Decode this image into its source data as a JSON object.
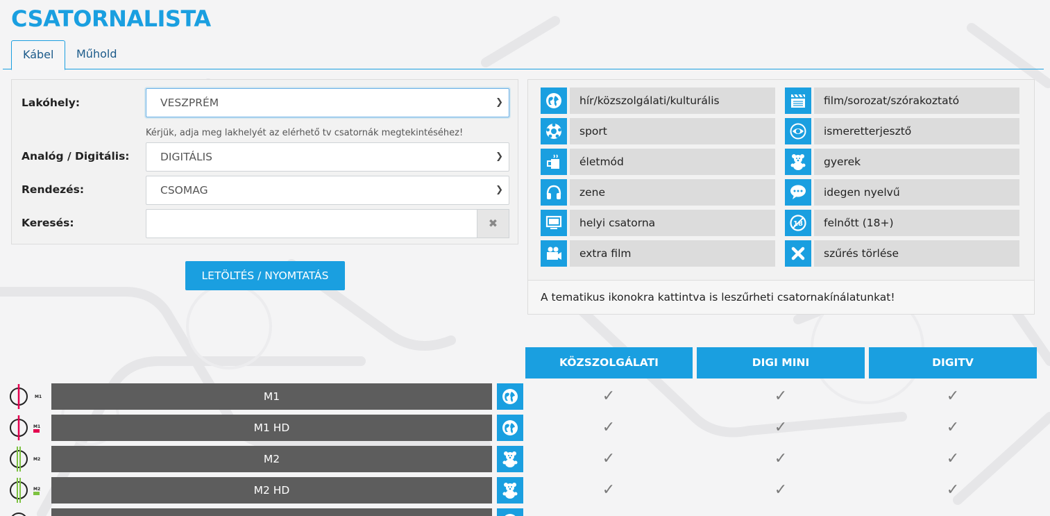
{
  "page_title": "CSATORNALISTA",
  "tabs": [
    {
      "label": "Kábel",
      "active": true
    },
    {
      "label": "Műhold",
      "active": false
    }
  ],
  "form": {
    "location": {
      "label": "Lakóhely:",
      "value": "VESZPRÉM",
      "hint": "Kérjük, adja meg lakhelyét az elérhető tv csatornák megtekintéséhez!"
    },
    "type": {
      "label": "Analóg / Digitális:",
      "value": "DIGITÁLIS"
    },
    "sort": {
      "label": "Rendezés:",
      "value": "CSOMAG"
    },
    "search": {
      "label": "Keresés:",
      "value": "",
      "placeholder": ""
    }
  },
  "download_button": "LETÖLTÉS / NYOMTATÁS",
  "legend": {
    "items": [
      {
        "label": "hír/közszolgálati/kulturális",
        "icon": "globe-icon"
      },
      {
        "label": "film/sorozat/szórakoztató",
        "icon": "clapperboard-icon"
      },
      {
        "label": "sport",
        "icon": "ball-icon"
      },
      {
        "label": "ismeretterjesztő",
        "icon": "eye-icon"
      },
      {
        "label": "életmód",
        "icon": "mug-icon"
      },
      {
        "label": "gyerek",
        "icon": "teddy-bear-icon"
      },
      {
        "label": "zene",
        "icon": "headphones-icon"
      },
      {
        "label": "idegen nyelvű",
        "icon": "speech-bubble-icon"
      },
      {
        "label": "helyi csatorna",
        "icon": "monitor-icon"
      },
      {
        "label": "felnőtt (18+)",
        "icon": "eighteen-plus-icon"
      },
      {
        "label": "extra film",
        "icon": "video-camera-icon"
      },
      {
        "label": "szűrés törlése",
        "icon": "close-icon"
      }
    ],
    "note": "A tematikus ikonokra kattintva is leszűrheti csatornakínálatunkat!"
  },
  "columns": [
    "KÖZSZOLGÁLATI",
    "DIGI MINI",
    "DIGITV"
  ],
  "channels": [
    {
      "name": "M1",
      "category_icon": "globe-icon",
      "logo_icon": "m1-logo",
      "logo_text": "M1",
      "available": [
        "✓",
        "✓",
        "✓"
      ]
    },
    {
      "name": "M1 HD",
      "category_icon": "globe-icon",
      "logo_icon": "m1-hd-logo",
      "logo_text": "M1",
      "available": [
        "✓",
        "✓",
        "✓"
      ]
    },
    {
      "name": "M2",
      "category_icon": "teddy-bear-icon",
      "logo_icon": "m2-logo",
      "logo_text": "M2",
      "available": [
        "✓",
        "✓",
        "✓"
      ]
    },
    {
      "name": "M2 HD",
      "category_icon": "teddy-bear-icon",
      "logo_icon": "m2-hd-logo",
      "logo_text": "M2",
      "available": [
        "✓",
        "✓",
        "✓"
      ]
    },
    {
      "name": "",
      "category_icon": "globe-icon",
      "logo_icon": "channel-logo",
      "logo_text": "",
      "available": [
        "✓",
        "✓",
        "✓"
      ]
    }
  ],
  "colors": {
    "accent": "#1a9fe0",
    "channel_bar": "#5d5d5d",
    "m1_red": "#e4004f",
    "m2_green": "#7dc241"
  }
}
